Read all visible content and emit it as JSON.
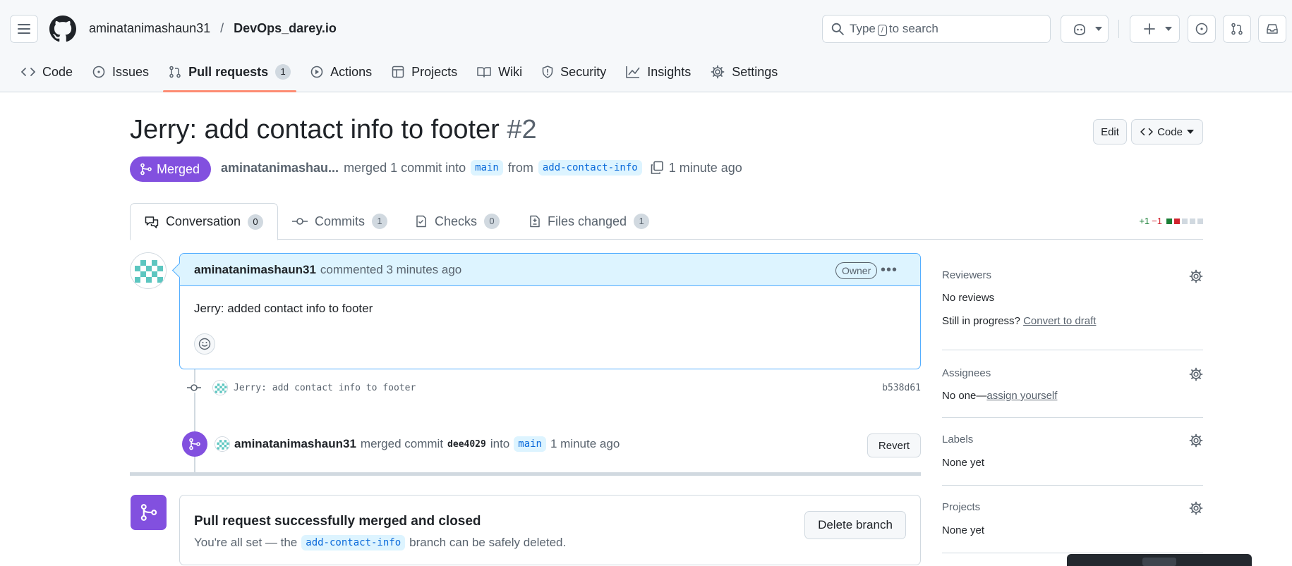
{
  "header": {
    "owner": "aminatanimashaun31",
    "separator": "/",
    "repo": "DevOps_darey.io",
    "search_prefix": "Type",
    "search_key": "/",
    "search_suffix": "to search"
  },
  "repo_nav": [
    {
      "label": "Code",
      "icon": "code-icon"
    },
    {
      "label": "Issues",
      "icon": "issue-icon"
    },
    {
      "label": "Pull requests",
      "icon": "pull-request-icon",
      "count": "1",
      "active": true
    },
    {
      "label": "Actions",
      "icon": "play-icon"
    },
    {
      "label": "Projects",
      "icon": "table-icon"
    },
    {
      "label": "Wiki",
      "icon": "book-icon"
    },
    {
      "label": "Security",
      "icon": "shield-icon"
    },
    {
      "label": "Insights",
      "icon": "graph-icon"
    },
    {
      "label": "Settings",
      "icon": "gear-icon"
    }
  ],
  "pr": {
    "title": "Jerry: add contact info to footer",
    "number": "#2",
    "edit_label": "Edit",
    "code_label": "Code",
    "state": "Merged",
    "author": "aminatanimashau...",
    "merged_text": "merged 1 commit into",
    "base_branch": "main",
    "from_text": "from",
    "head_branch": "add-contact-info",
    "time": "1 minute ago"
  },
  "tabs": [
    {
      "label": "Conversation",
      "count": "0",
      "icon": "comment-discussion-icon",
      "active": true
    },
    {
      "label": "Commits",
      "count": "1",
      "icon": "commit-icon"
    },
    {
      "label": "Checks",
      "count": "0",
      "icon": "checklist-icon"
    },
    {
      "label": "Files changed",
      "count": "1",
      "icon": "file-diff-icon"
    }
  ],
  "diffstat": {
    "additions": "+1",
    "deletions": "−1"
  },
  "comment": {
    "author": "aminatanimashaun31",
    "action": "commented 3 minutes ago",
    "badge": "Owner",
    "body": "Jerry: added contact info to footer"
  },
  "commit": {
    "message": "Jerry: add contact info to footer",
    "sha": "b538d61"
  },
  "merge_event": {
    "author": "aminatanimashaun31",
    "text1": "merged commit",
    "sha": "dee4029",
    "text2": "into",
    "branch": "main",
    "time": "1 minute ago",
    "revert_label": "Revert"
  },
  "merged_box": {
    "title": "Pull request successfully merged and closed",
    "sub1": "You're all set — the",
    "branch": "add-contact-info",
    "sub2": "branch can be safely deleted.",
    "delete_label": "Delete branch"
  },
  "sidebar": {
    "reviewers": {
      "heading": "Reviewers",
      "value": "No reviews",
      "progress_text": "Still in progress?",
      "progress_link": "Convert to draft"
    },
    "assignees": {
      "heading": "Assignees",
      "value": "No one—",
      "link": "assign yourself"
    },
    "labels": {
      "heading": "Labels",
      "value": "None yet"
    },
    "projects": {
      "heading": "Projects",
      "value": "None yet"
    }
  },
  "colors": {
    "merged": "#8250df",
    "accent": "#0969da",
    "underline": "#fd8c73"
  }
}
